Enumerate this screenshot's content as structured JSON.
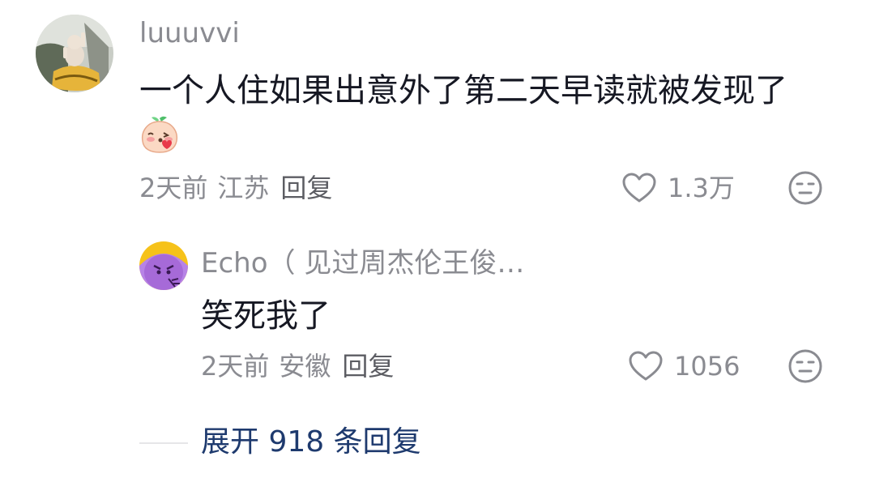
{
  "comment": {
    "username": "luuuvvi",
    "text": "一个人住如果出意外了第二天早读就被发现了",
    "sticker_icon": "blushing-peach-sticker",
    "time": "2天前",
    "location": "江苏",
    "reply_label": "回复",
    "like_count": "1.3万"
  },
  "reply": {
    "username": "Echo（ 见过周杰伦王俊…",
    "text": "笑死我了",
    "time": "2天前",
    "location": "安徽",
    "reply_label": "回复",
    "like_count": "1056"
  },
  "expand": {
    "label": "展开 918 条回复"
  },
  "colors": {
    "secondary_text": "#8a8b91",
    "primary_text": "#161823",
    "expand_link": "#1e3a6e"
  }
}
